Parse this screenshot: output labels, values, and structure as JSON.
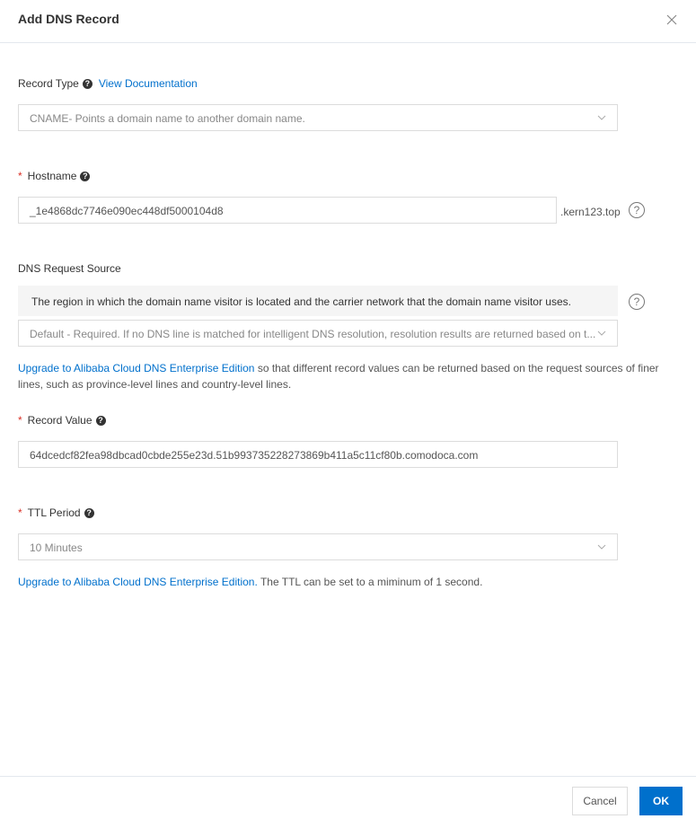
{
  "dialog": {
    "title": "Add DNS Record",
    "close_icon": "close-icon"
  },
  "record_type": {
    "label": "Record Type",
    "help_icon": "help-icon",
    "doc_link": "View Documentation",
    "selected": "CNAME- Points a domain name to another domain name."
  },
  "hostname": {
    "label": "Hostname",
    "required": "*",
    "value": "_1e4868dc7746e090ec448df5000104d8",
    "suffix": ".kern123.top"
  },
  "dns_request_source": {
    "label": "DNS Request Source",
    "hint": "The region in which the domain name visitor is located and the carrier network that the domain name visitor uses.",
    "selected": "Default - Required. If no DNS line is matched for intelligent DNS resolution, resolution results are returned based on t...",
    "upgrade_link": "Upgrade to Alibaba Cloud DNS Enterprise Edition",
    "upgrade_text": " so that different record values can be returned based on the request sources of finer lines, such as province-level lines and country-level lines."
  },
  "record_value": {
    "label": "Record Value",
    "required": "*",
    "value": "64dcedcf82fea98dbcad0cbde255e23d.51b993735228273869b411a5c11cf80b.comodoca.com"
  },
  "ttl": {
    "label": "TTL Period",
    "required": "*",
    "selected": "10 Minutes",
    "upgrade_link": "Upgrade to Alibaba Cloud DNS Enterprise Edition.",
    "upgrade_text": " The TTL can be set to a miminum of 1 second."
  },
  "footer": {
    "cancel_label": "Cancel",
    "ok_label": "OK"
  },
  "colors": {
    "accent": "#0070cc",
    "required": "#d93026"
  }
}
